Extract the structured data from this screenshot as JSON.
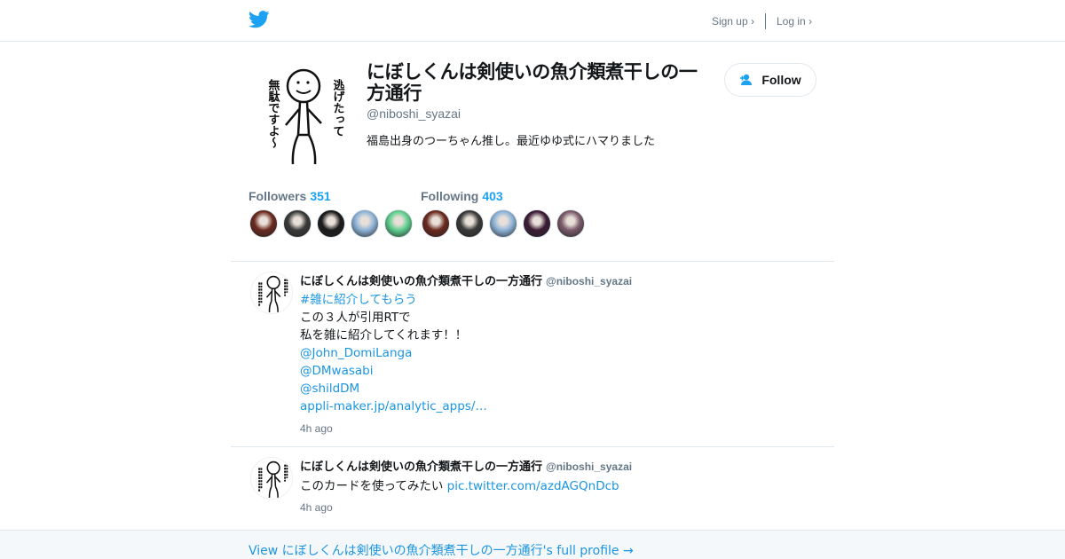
{
  "header": {
    "logo_icon": "twitter-bird-icon",
    "signup": "Sign up ›",
    "login": "Log in ›",
    "brand_color": "#1da1f2"
  },
  "profile": {
    "name": "にぼしくんは剣使いの魚介類煮干しの一方通行",
    "handle": "@niboshi_syazai",
    "bio": "福島出身のつーちゃん推し。最近ゆゆ式にハマりました",
    "avatar_text_right": "逃げたって",
    "avatar_text_left": "無駄ですよ〜",
    "follow_label": "Follow",
    "follow_icon": "add-user-icon"
  },
  "stats": {
    "followers_label": "Followers",
    "followers_count": "351",
    "following_label": "Following",
    "following_count": "403",
    "follower_avatars": [
      "#6b2a1f",
      "#3a3a3a",
      "#1b1b1b",
      "#8fb4d8",
      "#5fcf8f"
    ],
    "following_avatars": [
      "#6b2a1f",
      "#3a3a3a",
      "#8fb4d8",
      "#3b1b36",
      "#7a5b6a"
    ]
  },
  "tweets": [
    {
      "name": "にぼしくんは剣使いの魚介類煮干しの一方通行",
      "handle": "@niboshi_syazai",
      "hashtag": "#雑に紹介してもらう",
      "line1": "この３人が引用RTで",
      "line2": "私を雑に紹介してくれます！！",
      "mention1": "@John_DomiLanga",
      "mention2": "@DMwasabi",
      "mention3": "@shildDM",
      "link": " appli-maker.jp/analytic_apps/…",
      "time": "4h ago"
    },
    {
      "name": "にぼしくんは剣使いの魚介類煮干しの一方通行",
      "handle": "@niboshi_syazai",
      "text": "このカードを使ってみたい ",
      "link": "pic.twitter.com/azdAGQnDcb",
      "time": "4h ago"
    }
  ],
  "footer": {
    "link": "View にぼしくんは剣使いの魚介類煮干しの一方通行's full profile →"
  }
}
